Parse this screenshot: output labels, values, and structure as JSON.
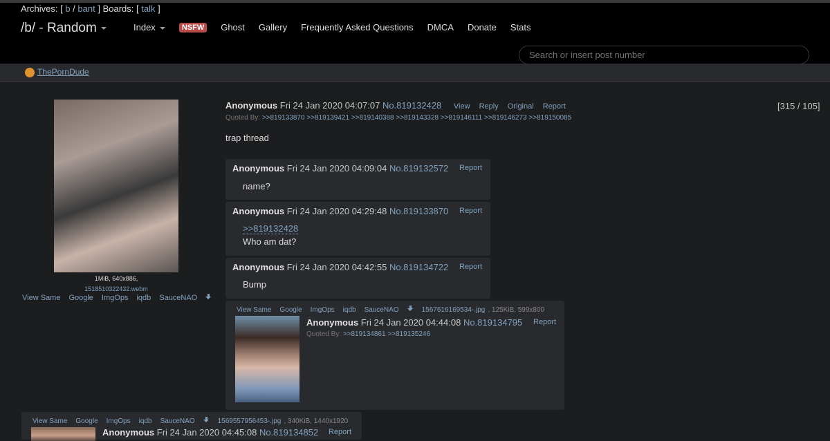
{
  "nav": {
    "archives_label": "Archives: [",
    "archive_b": "b",
    "archive_sep": "/",
    "archive_bant": "bant",
    "boards_label": "] Boards: [",
    "board_talk": "talk",
    "board_close": "]",
    "title": "/b/ - Random",
    "links": {
      "index": "Index",
      "nsfw": "NSFW",
      "ghost": "Ghost",
      "gallery": "Gallery",
      "faq": "Frequently Asked Questions",
      "dmca": "DMCA",
      "donate": "Donate",
      "stats": "Stats"
    },
    "search_placeholder": "Search or insert post number"
  },
  "sponsor": {
    "label": "ThePornDude"
  },
  "op": {
    "name": "Anonymous",
    "date": "Fri 24 Jan 2020 04:07:07",
    "no": "No.819132428",
    "controls": [
      "View",
      "Reply",
      "Original",
      "Report"
    ],
    "quoted_label": "Quoted By:",
    "quoted_by": ">>819133870 >>819139421 >>819140388 >>819143328 >>819146111 >>819146273 >>819150085",
    "text": "trap thread",
    "counter": "[315 / 105]",
    "file_meta": "1MiB, 640x886,",
    "file_name": "1518510322432.webm",
    "tools": [
      "View Same",
      "Google",
      "ImgOps",
      "iqdb",
      "SauceNAO"
    ]
  },
  "replies": [
    {
      "name": "Anonymous",
      "date": "Fri 24 Jan 2020 04:09:04",
      "no": "No.819132572",
      "report": "Report",
      "text": "name?"
    },
    {
      "name": "Anonymous",
      "date": "Fri 24 Jan 2020 04:29:48",
      "no": "No.819133870",
      "report": "Report",
      "quote": ">>819132428",
      "text": "Who am dat?"
    },
    {
      "name": "Anonymous",
      "date": "Fri 24 Jan 2020 04:42:55",
      "no": "No.819134722",
      "report": "Report",
      "text": "Bump"
    },
    {
      "tools": [
        "View Same",
        "Google",
        "ImgOps",
        "iqdb",
        "SauceNAO"
      ],
      "file_name": "1567616169534-.jpg",
      "file_meta": ", 125KiB, 599x800",
      "name": "Anonymous",
      "date": "Fri 24 Jan 2020 04:44:08",
      "no": "No.819134795",
      "report": "Report",
      "quoted_label": "Quoted By:",
      "quoted_by": ">>819134861 >>819135246"
    },
    {
      "tools": [
        "View Same",
        "Google",
        "ImgOps",
        "iqdb",
        "SauceNAO"
      ],
      "file_name": "1569557956453-.jpg",
      "file_meta": ", 340KiB, 1440x1920",
      "name": "Anonymous",
      "date": "Fri 24 Jan 2020 04:45:08",
      "no": "No.819134852",
      "report": "Report"
    }
  ]
}
